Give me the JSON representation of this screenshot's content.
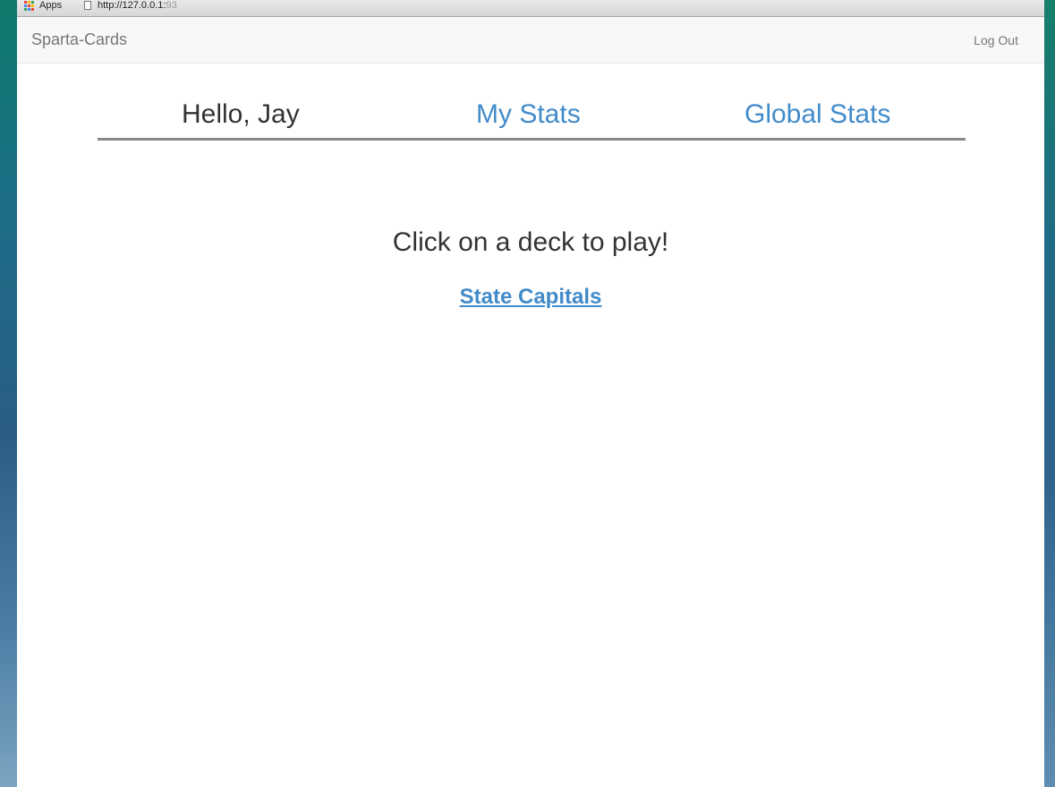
{
  "browser": {
    "bookmarks": {
      "apps_label": "Apps",
      "url_text": "http://127.0.0.1:",
      "url_fade": "93"
    },
    "apps_grid_colors": [
      "#e94235",
      "#fbbc05",
      "#34a853",
      "#4285f4",
      "#e94235",
      "#fbbc05",
      "#34a853",
      "#4285f4",
      "#e94235"
    ]
  },
  "navbar": {
    "brand": "Sparta-Cards",
    "logout_label": "Log Out"
  },
  "tabs": {
    "greeting": "Hello, Jay",
    "my_stats": "My Stats",
    "global_stats": "Global Stats"
  },
  "main": {
    "heading": "Click on a deck to play!",
    "decks": [
      "State Capitals"
    ]
  },
  "colors": {
    "link": "#428bca",
    "text": "#333333",
    "navbar_text": "#777777",
    "tab_underline": "#888888"
  }
}
